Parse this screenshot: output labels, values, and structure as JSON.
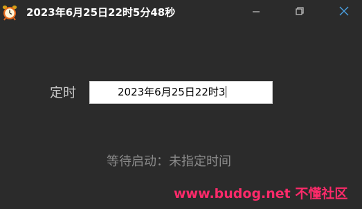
{
  "window": {
    "title": "2023年6月25日22时5分48秒",
    "app_icon": "alarm-clock-icon",
    "controls": {
      "minimize_icon": "minimize-icon",
      "maximize_icon": "restore-icon",
      "close_icon": "close-icon"
    }
  },
  "main": {
    "timing_label": "定时",
    "time_input_value": "2023年6月25日22时3",
    "status_text": "等待启动：未指定时间"
  },
  "watermark": {
    "text": "www.budog.net 不懂社区"
  },
  "colors": {
    "background": "#2b2b2b",
    "watermark": "#ff2a6a",
    "status_text": "#8a8a8a",
    "close_icon": "#4a9fe0"
  }
}
